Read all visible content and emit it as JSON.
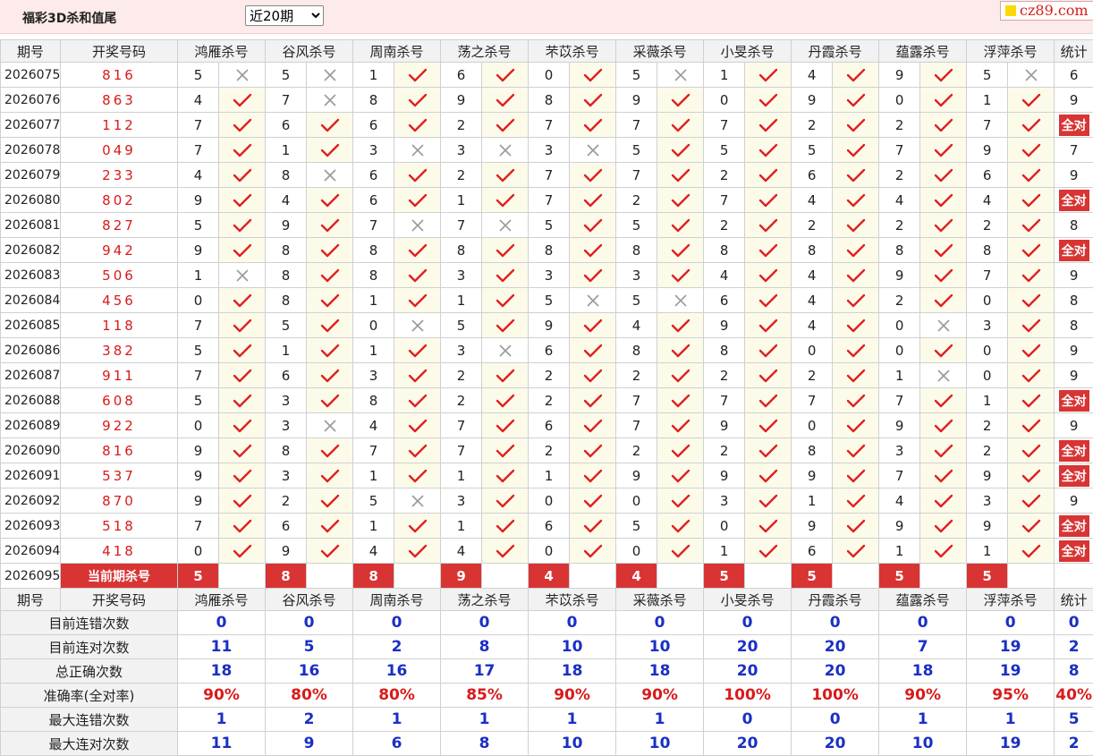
{
  "app": {
    "title": "福彩3D杀和值尾",
    "period_selected": "近20期",
    "brand": "cz89.com"
  },
  "header": {
    "period": "期号",
    "numbers": "开奖号码",
    "stat": "统计"
  },
  "experts": [
    "鸿雁杀号",
    "谷风杀号",
    "周南杀号",
    "荡之杀号",
    "芣苡杀号",
    "采薇杀号",
    "小旻杀号",
    "丹霞杀号",
    "蕴露杀号",
    "浮萍杀号"
  ],
  "rows": [
    {
      "period": "2026075",
      "nums": "816",
      "vals": [
        "5",
        "5",
        "1",
        "6",
        "0",
        "5",
        "1",
        "4",
        "9",
        "5"
      ],
      "ok": [
        0,
        0,
        1,
        1,
        1,
        0,
        1,
        1,
        1,
        0
      ],
      "stat": "6"
    },
    {
      "period": "2026076",
      "nums": "863",
      "vals": [
        "4",
        "7",
        "8",
        "9",
        "8",
        "9",
        "0",
        "9",
        "0",
        "1"
      ],
      "ok": [
        1,
        0,
        1,
        1,
        1,
        1,
        1,
        1,
        1,
        1
      ],
      "stat": "9"
    },
    {
      "period": "2026077",
      "nums": "112",
      "vals": [
        "7",
        "6",
        "6",
        "2",
        "7",
        "7",
        "7",
        "2",
        "2",
        "7"
      ],
      "ok": [
        1,
        1,
        1,
        1,
        1,
        1,
        1,
        1,
        1,
        1
      ],
      "stat": "全对"
    },
    {
      "period": "2026078",
      "nums": "049",
      "vals": [
        "7",
        "1",
        "3",
        "3",
        "3",
        "5",
        "5",
        "5",
        "7",
        "9"
      ],
      "ok": [
        1,
        1,
        0,
        0,
        0,
        1,
        1,
        1,
        1,
        1
      ],
      "stat": "7"
    },
    {
      "period": "2026079",
      "nums": "233",
      "vals": [
        "4",
        "8",
        "6",
        "2",
        "7",
        "7",
        "2",
        "6",
        "2",
        "6"
      ],
      "ok": [
        1,
        0,
        1,
        1,
        1,
        1,
        1,
        1,
        1,
        1
      ],
      "stat": "9"
    },
    {
      "period": "2026080",
      "nums": "802",
      "vals": [
        "9",
        "4",
        "6",
        "1",
        "7",
        "2",
        "7",
        "4",
        "4",
        "4"
      ],
      "ok": [
        1,
        1,
        1,
        1,
        1,
        1,
        1,
        1,
        1,
        1
      ],
      "stat": "全对"
    },
    {
      "period": "2026081",
      "nums": "827",
      "vals": [
        "5",
        "9",
        "7",
        "7",
        "5",
        "5",
        "2",
        "2",
        "2",
        "2"
      ],
      "ok": [
        1,
        1,
        0,
        0,
        1,
        1,
        1,
        1,
        1,
        1
      ],
      "stat": "8"
    },
    {
      "period": "2026082",
      "nums": "942",
      "vals": [
        "9",
        "8",
        "8",
        "8",
        "8",
        "8",
        "8",
        "8",
        "8",
        "8"
      ],
      "ok": [
        1,
        1,
        1,
        1,
        1,
        1,
        1,
        1,
        1,
        1
      ],
      "stat": "全对"
    },
    {
      "period": "2026083",
      "nums": "506",
      "vals": [
        "1",
        "8",
        "8",
        "3",
        "3",
        "3",
        "4",
        "4",
        "9",
        "7"
      ],
      "ok": [
        0,
        1,
        1,
        1,
        1,
        1,
        1,
        1,
        1,
        1
      ],
      "stat": "9"
    },
    {
      "period": "2026084",
      "nums": "456",
      "vals": [
        "0",
        "8",
        "1",
        "1",
        "5",
        "5",
        "6",
        "4",
        "2",
        "0"
      ],
      "ok": [
        1,
        1,
        1,
        1,
        0,
        0,
        1,
        1,
        1,
        1
      ],
      "stat": "8"
    },
    {
      "period": "2026085",
      "nums": "118",
      "vals": [
        "7",
        "5",
        "0",
        "5",
        "9",
        "4",
        "9",
        "4",
        "0",
        "3"
      ],
      "ok": [
        1,
        1,
        0,
        1,
        1,
        1,
        1,
        1,
        0,
        1
      ],
      "stat": "8"
    },
    {
      "period": "2026086",
      "nums": "382",
      "vals": [
        "5",
        "1",
        "1",
        "3",
        "6",
        "8",
        "8",
        "0",
        "0",
        "0"
      ],
      "ok": [
        1,
        1,
        1,
        0,
        1,
        1,
        1,
        1,
        1,
        1
      ],
      "stat": "9"
    },
    {
      "period": "2026087",
      "nums": "911",
      "vals": [
        "7",
        "6",
        "3",
        "2",
        "2",
        "2",
        "2",
        "2",
        "1",
        "0"
      ],
      "ok": [
        1,
        1,
        1,
        1,
        1,
        1,
        1,
        1,
        0,
        1
      ],
      "stat": "9"
    },
    {
      "period": "2026088",
      "nums": "608",
      "vals": [
        "5",
        "3",
        "8",
        "2",
        "2",
        "7",
        "7",
        "7",
        "7",
        "1"
      ],
      "ok": [
        1,
        1,
        1,
        1,
        1,
        1,
        1,
        1,
        1,
        1
      ],
      "stat": "全对"
    },
    {
      "period": "2026089",
      "nums": "922",
      "vals": [
        "0",
        "3",
        "4",
        "7",
        "6",
        "7",
        "9",
        "0",
        "9",
        "2"
      ],
      "ok": [
        1,
        0,
        1,
        1,
        1,
        1,
        1,
        1,
        1,
        1
      ],
      "stat": "9"
    },
    {
      "period": "2026090",
      "nums": "816",
      "vals": [
        "9",
        "8",
        "7",
        "7",
        "2",
        "2",
        "2",
        "8",
        "3",
        "2"
      ],
      "ok": [
        1,
        1,
        1,
        1,
        1,
        1,
        1,
        1,
        1,
        1
      ],
      "stat": "全对"
    },
    {
      "period": "2026091",
      "nums": "537",
      "vals": [
        "9",
        "3",
        "1",
        "1",
        "1",
        "9",
        "9",
        "9",
        "7",
        "9"
      ],
      "ok": [
        1,
        1,
        1,
        1,
        1,
        1,
        1,
        1,
        1,
        1
      ],
      "stat": "全对"
    },
    {
      "period": "2026092",
      "nums": "870",
      "vals": [
        "9",
        "2",
        "5",
        "3",
        "0",
        "0",
        "3",
        "1",
        "4",
        "3"
      ],
      "ok": [
        1,
        1,
        0,
        1,
        1,
        1,
        1,
        1,
        1,
        1
      ],
      "stat": "9"
    },
    {
      "period": "2026093",
      "nums": "518",
      "vals": [
        "7",
        "6",
        "1",
        "1",
        "6",
        "5",
        "0",
        "9",
        "9",
        "9"
      ],
      "ok": [
        1,
        1,
        1,
        1,
        1,
        1,
        1,
        1,
        1,
        1
      ],
      "stat": "全对"
    },
    {
      "period": "2026094",
      "nums": "418",
      "vals": [
        "0",
        "9",
        "4",
        "4",
        "0",
        "0",
        "1",
        "6",
        "1",
        "1"
      ],
      "ok": [
        1,
        1,
        1,
        1,
        1,
        1,
        1,
        1,
        1,
        1
      ],
      "stat": "全对"
    }
  ],
  "current": {
    "period": "2026095",
    "label": "当前期杀号",
    "vals": [
      "5",
      "8",
      "8",
      "9",
      "4",
      "4",
      "5",
      "5",
      "5",
      "5"
    ]
  },
  "stats": [
    {
      "label": "目前连错次数",
      "vals": [
        "0",
        "0",
        "0",
        "0",
        "0",
        "0",
        "0",
        "0",
        "0",
        "0"
      ],
      "stat": "0",
      "red": false
    },
    {
      "label": "目前连对次数",
      "vals": [
        "11",
        "5",
        "2",
        "8",
        "10",
        "10",
        "20",
        "20",
        "7",
        "19"
      ],
      "stat": "2",
      "red": false
    },
    {
      "label": "总正确次数",
      "vals": [
        "18",
        "16",
        "16",
        "17",
        "18",
        "18",
        "20",
        "20",
        "18",
        "19"
      ],
      "stat": "8",
      "red": false
    },
    {
      "label": "准确率(全对率)",
      "vals": [
        "90%",
        "80%",
        "80%",
        "85%",
        "90%",
        "90%",
        "100%",
        "100%",
        "90%",
        "95%"
      ],
      "stat": "40%",
      "red": true
    },
    {
      "label": "最大连错次数",
      "vals": [
        "1",
        "2",
        "1",
        "1",
        "1",
        "1",
        "0",
        "0",
        "1",
        "1"
      ],
      "stat": "5",
      "red": false
    },
    {
      "label": "最大连对次数",
      "vals": [
        "11",
        "9",
        "6",
        "8",
        "10",
        "10",
        "20",
        "20",
        "10",
        "19"
      ],
      "stat": "2",
      "red": false
    }
  ]
}
